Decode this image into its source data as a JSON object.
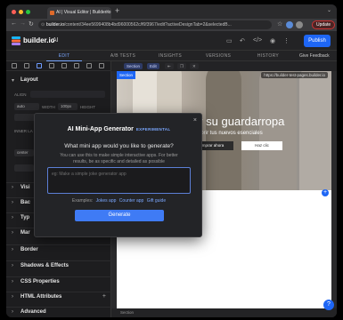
{
  "browser": {
    "tab_title": "AI | Visual Editor | Builder.io",
    "url_domain": "builder.io",
    "url_path": "/content/34ee5699408b4bd96000562c/f6f3967/edit?activeDesignTab=2&selectedB...",
    "update_label": "Update"
  },
  "app": {
    "brand": "builder.io",
    "project": "AI",
    "publish_label": "Publish",
    "tabs": [
      "EDIT",
      "A/B TESTS",
      "INSIGHTS",
      "VERSIONS",
      "HISTORY"
    ],
    "active_tab": "EDIT",
    "feedback_label": "Give Feedback"
  },
  "left_panel": {
    "layout_title": "Layout",
    "align_label": "ALIGN",
    "width_label": "WIDTH",
    "width_value": "100px",
    "height_label": "HEIGHT",
    "auto_value": "auto",
    "inner_label": "INNER LA",
    "center_value": "center",
    "sections": [
      "Visi",
      "Bac",
      "Typ",
      "Mar",
      "Border",
      "Shadows & Effects",
      "CSS Properties",
      "HTML Attributes",
      "Advanced"
    ]
  },
  "canvas": {
    "sel_label": "Section",
    "chip_label": "Edit",
    "url_chip": "https://builder-test-pages.builder.io",
    "hero_title": "ar su guardarropa",
    "hero_subtitle": "scubrir tus nuevos esenciales",
    "button_primary": "mprar ahora",
    "button_secondary": "Haz clic",
    "bottom_label": "Section",
    "help_label": "?"
  },
  "modal": {
    "title": "AI Mini-App Generator",
    "badge": "EXPERIMENTAL",
    "question": "What mini app would you like to generate?",
    "description": "You can use this to make simple interactive apps. For better results, be as specific and detailed as possible",
    "placeholder": "eg: Make a simple joke generator app",
    "examples_label": "Examples:",
    "examples": [
      "Jokes app",
      "Counter app",
      "Gift guide"
    ],
    "generate_label": "Generate"
  },
  "colors": {
    "accent": "#1e66f5",
    "link": "#7aa7ff",
    "panel": "#1d1d1f"
  }
}
